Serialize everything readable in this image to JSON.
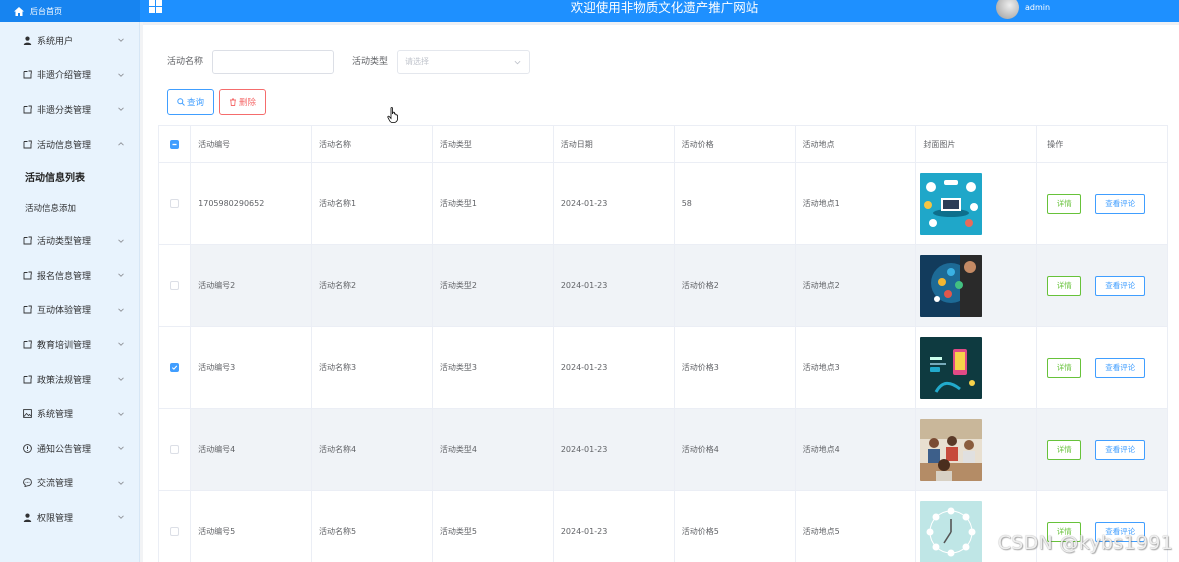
{
  "header": {
    "brand_label": "后台首页",
    "site_title": "欢迎使用非物质文化遗产推广网站",
    "username": "admin"
  },
  "sidebar": {
    "items": [
      {
        "label": "系统用户",
        "icon": "user-icon"
      },
      {
        "label": "非遗介绍管理",
        "icon": "folder-icon"
      },
      {
        "label": "非遗分类管理",
        "icon": "folder-icon"
      },
      {
        "label": "活动信息管理",
        "icon": "folder-icon",
        "expanded": true
      },
      {
        "label": "活动类型管理",
        "icon": "folder-icon"
      },
      {
        "label": "报名信息管理",
        "icon": "folder-icon"
      },
      {
        "label": "互动体验管理",
        "icon": "folder-icon"
      },
      {
        "label": "教育培训管理",
        "icon": "folder-icon"
      },
      {
        "label": "政策法规管理",
        "icon": "folder-icon"
      },
      {
        "label": "系统管理",
        "icon": "image-icon"
      },
      {
        "label": "通知公告管理",
        "icon": "info-icon"
      },
      {
        "label": "交流管理",
        "icon": "chat-icon"
      },
      {
        "label": "权限管理",
        "icon": "user-icon"
      }
    ],
    "submenu": [
      {
        "label": "活动信息列表",
        "active": true
      },
      {
        "label": "活动信息添加",
        "active": false
      }
    ]
  },
  "search": {
    "name_label": "活动名称",
    "name_value": "",
    "type_label": "活动类型",
    "type_placeholder": "请选择",
    "query_label": "查询",
    "delete_label": "删除"
  },
  "table": {
    "columns": [
      "活动编号",
      "活动名称",
      "活动类型",
      "活动日期",
      "活动价格",
      "活动地点",
      "封面图片",
      "操作"
    ],
    "rows": [
      {
        "id": "1705980290652",
        "name": "活动名称1",
        "type": "活动类型1",
        "date": "2024-01-23",
        "price": "58",
        "place": "活动地点1",
        "checked": false
      },
      {
        "id": "活动编号2",
        "name": "活动名称2",
        "type": "活动类型2",
        "date": "2024-01-23",
        "price": "活动价格2",
        "place": "活动地点2",
        "checked": false
      },
      {
        "id": "活动编号3",
        "name": "活动名称3",
        "type": "活动类型3",
        "date": "2024-01-23",
        "price": "活动价格3",
        "place": "活动地点3",
        "checked": true
      },
      {
        "id": "活动编号4",
        "name": "活动名称4",
        "type": "活动类型4",
        "date": "2024-01-23",
        "price": "活动价格4",
        "place": "活动地点4",
        "checked": false
      },
      {
        "id": "活动编号5",
        "name": "活动名称5",
        "type": "活动类型5",
        "date": "2024-01-23",
        "price": "活动价格5",
        "place": "活动地点5",
        "checked": false
      }
    ],
    "detail_label": "详情",
    "comment_label": "查看评论"
  },
  "watermark": "CSDN @kybs1991",
  "colors": {
    "primary": "#409eff",
    "header_bg": "#1e90ff",
    "danger": "#f56c6c",
    "success": "#67c23a",
    "sidebar_bg": "#e8f3fd"
  }
}
